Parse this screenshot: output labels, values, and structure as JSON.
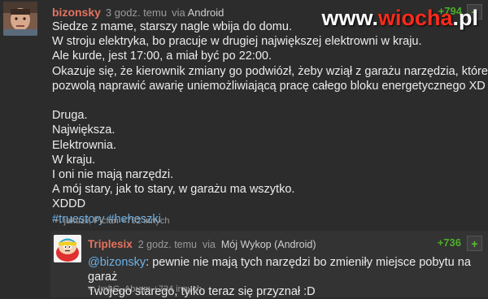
{
  "watermark": {
    "prefix": "www.",
    "brand": "wiocha",
    "suffix": ".pl"
  },
  "post": {
    "author": "bizonsky",
    "time": "3 godz. temu",
    "via_label": "via",
    "source": "Android",
    "votes": "+794",
    "plus_label": "+",
    "lines": [
      "Siedze z mame, starszy nagle wbija do domu.",
      "W stroju elektryka, bo pracuje w drugiej największej elektrowni w kraju.",
      "Ale kurde, jest 17:00, a miał być po 22:00.",
      "Okazuje się, że kierownik zmiany go podwiózł, żeby wziął z garażu narzędzia, które",
      "pozwolą naprawić awarię uniemożliwiającą pracę całego bloku energetycznego XD",
      "",
      "Druga.",
      "Największa.",
      "Elektrownia.",
      "W kraju.",
      "I oni nie mają narzędzi.",
      "A mój stary, jak to stary, w garażu ma wszytko.",
      "XDDD"
    ],
    "tags": [
      "#truestory",
      "#heheszki"
    ],
    "voters": "+: jakuzii, Picfan +792 innych"
  },
  "reply": {
    "author": "Triplesix",
    "time": "2 godz. temu",
    "via_label": "via",
    "source": "Mój Wykop (Android)",
    "votes": "+736",
    "plus_label": "+",
    "mention": "@bizonsky",
    "text_after_mention": ": pewnie nie mają tych narzędzi bo zmieniły miejsce pobytu na garaż",
    "line2": "Twojego starego, tylko teraz się przyznał :D",
    "voters": "+: ImhG, Abram +734 innych"
  }
}
